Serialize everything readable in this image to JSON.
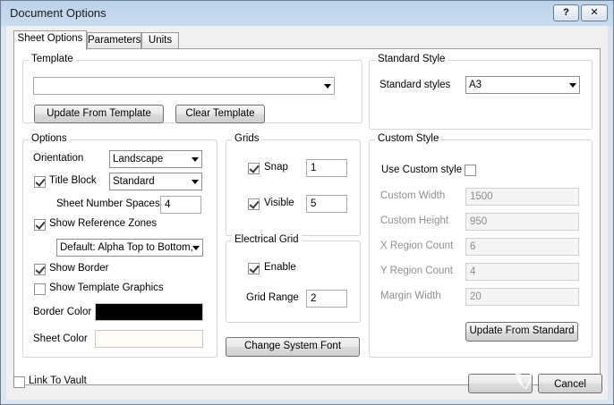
{
  "window": {
    "title": "Document Options",
    "help_glyph": "?",
    "close_glyph": "✕"
  },
  "tabs": [
    "Sheet Options",
    "Parameters",
    "Units"
  ],
  "template": {
    "group_label": "Template",
    "value": "",
    "update_button": "Update From Template",
    "clear_button": "Clear Template"
  },
  "standard_style": {
    "group_label": "Standard Style",
    "label": "Standard styles",
    "value": "A3"
  },
  "options": {
    "group_label": "Options",
    "orientation_label": "Orientation",
    "orientation_value": "Landscape",
    "title_block_label": "Title Block",
    "title_block_value": "Standard",
    "title_block_checked": true,
    "sheet_number_spaces_label": "Sheet Number Spaces",
    "sheet_number_spaces_value": "4",
    "show_reference_zones_label": "Show Reference Zones",
    "show_reference_zones_checked": true,
    "reference_zones_value": "Default: Alpha Top to Bottom,",
    "show_border_label": "Show Border",
    "show_border_checked": true,
    "show_template_graphics_label": "Show Template Graphics",
    "show_template_graphics_checked": false,
    "border_color_label": "Border Color",
    "border_color": "#000000",
    "sheet_color_label": "Sheet Color",
    "sheet_color": "#fffcf8"
  },
  "grids": {
    "group_label": "Grids",
    "snap_label": "Snap",
    "snap_checked": true,
    "snap_value": "1",
    "visible_label": "Visible",
    "visible_checked": true,
    "visible_value": "5"
  },
  "electrical_grid": {
    "group_label": "Electrical Grid",
    "enable_label": "Enable",
    "enable_checked": true,
    "grid_range_label": "Grid Range",
    "grid_range_value": "2"
  },
  "change_font_button": "Change System Font",
  "custom_style": {
    "group_label": "Custom Style",
    "use_custom_label": "Use Custom style",
    "use_custom_checked": false,
    "fields": [
      {
        "label": "Custom Width",
        "value": "1500"
      },
      {
        "label": "Custom Height",
        "value": "950"
      },
      {
        "label": "X Region Count",
        "value": "6"
      },
      {
        "label": "Y Region Count",
        "value": "4"
      },
      {
        "label": "Margin Width",
        "value": "20"
      }
    ],
    "update_button": "Update From Standard"
  },
  "link_to_vault": {
    "label": "Link To Vault",
    "checked": false
  },
  "footer": {
    "ok_label": "",
    "cancel_label": "Cancel"
  }
}
